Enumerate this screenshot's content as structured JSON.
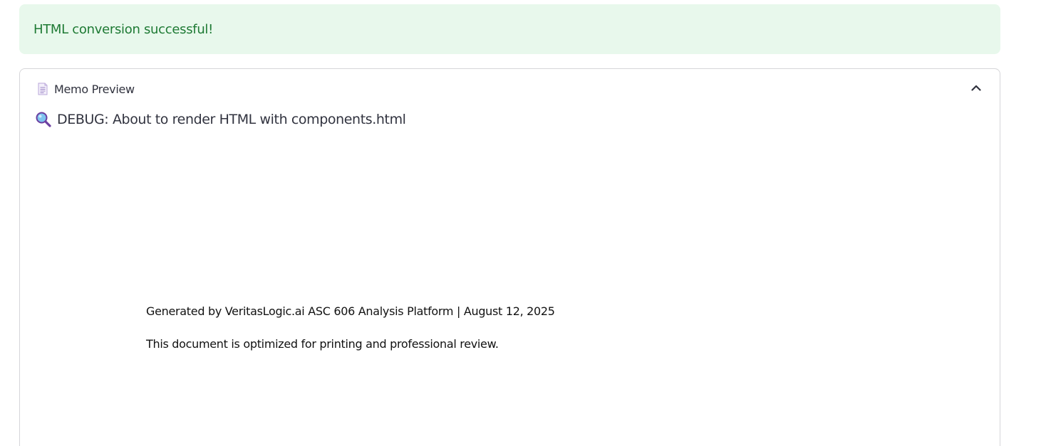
{
  "alert": {
    "message": "HTML conversion successful!",
    "bg_color": "#e8f8ec",
    "text_color": "#1e7a34"
  },
  "expander": {
    "icon": "memo-icon",
    "label": "Memo Preview",
    "toggle_icon": "chevron-up-icon",
    "expanded": true
  },
  "debug": {
    "icon": "magnifier-icon",
    "text": "DEBUG: About to render HTML with components.html"
  },
  "memo": {
    "footer_line_1": "Generated by VeritasLogic.ai ASC 606 Analysis Platform | August 12, 2025",
    "footer_line_2": "This document is optimized for printing and professional review."
  }
}
